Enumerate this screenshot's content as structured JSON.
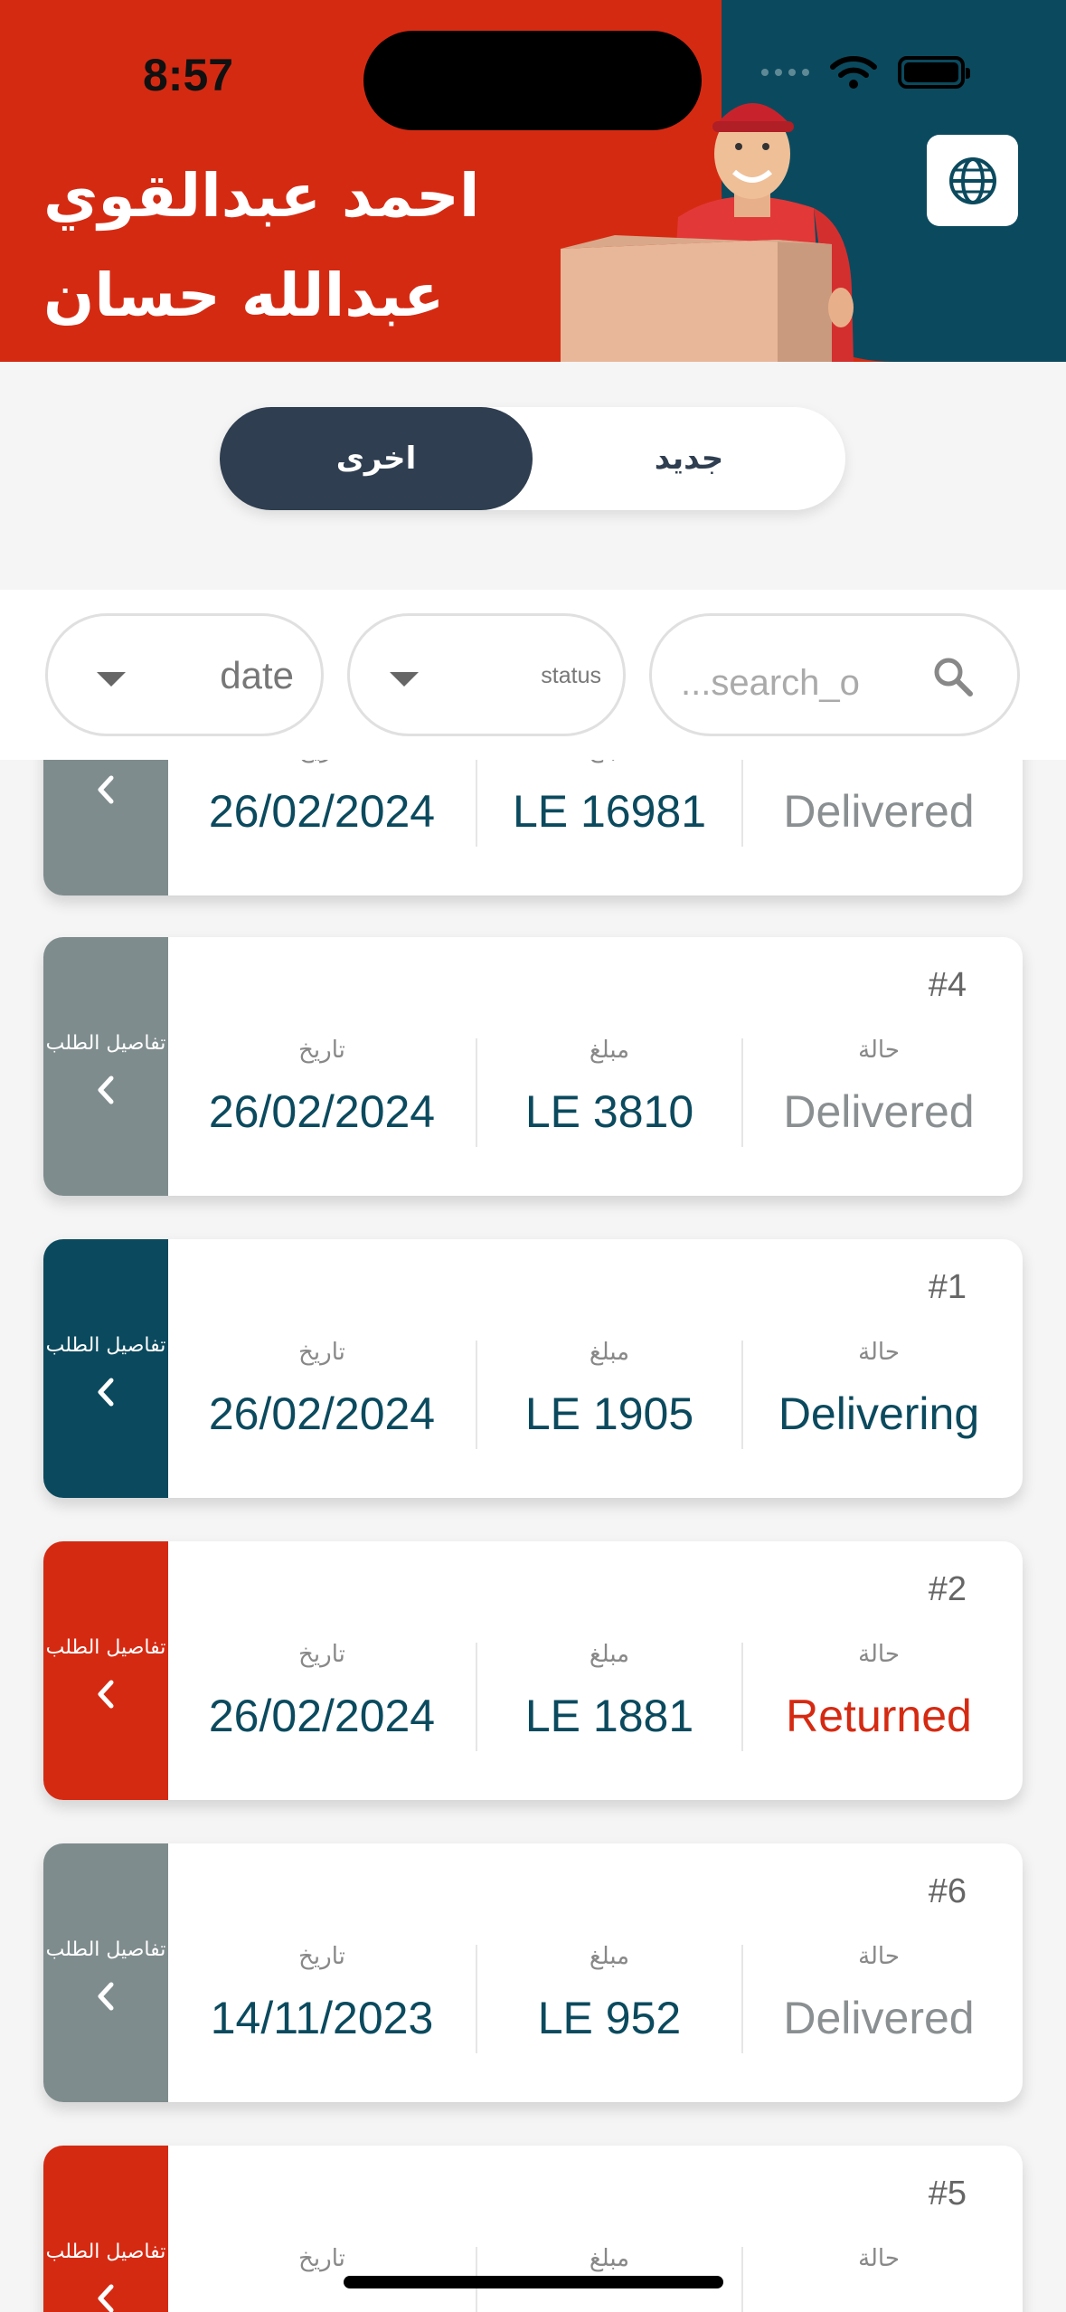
{
  "status_bar": {
    "time": "8:57"
  },
  "header": {
    "user_name": "احمد عبدالقوي عبدالله حسان"
  },
  "toggle": {
    "active_label": "اخرى",
    "inactive_label": "جديد"
  },
  "filters": {
    "date_label": "date",
    "status_label": "status",
    "search_placeholder": "...search_o"
  },
  "labels": {
    "details": "تفاصيل الطلب",
    "date": "تاريخ",
    "amount": "مبلغ",
    "status": "حالة"
  },
  "colors": {
    "red": "#d52a12",
    "teal": "#0b4a5e",
    "gray": "#7f8c8d",
    "navy": "#2f3e50"
  },
  "orders": [
    {
      "number": "",
      "date": "26/02/2024",
      "amount": "LE 16981",
      "status": "Delivered",
      "status_color": "#8a8f91",
      "side_color": "#7f8c8d"
    },
    {
      "number": "#4",
      "date": "26/02/2024",
      "amount": "LE 3810",
      "status": "Delivered",
      "status_color": "#8a8f91",
      "side_color": "#7f8c8d"
    },
    {
      "number": "#1",
      "date": "26/02/2024",
      "amount": "LE 1905",
      "status": "Delivering",
      "status_color": "#0b4a5e",
      "side_color": "#0b4a5e"
    },
    {
      "number": "#2",
      "date": "26/02/2024",
      "amount": "LE 1881",
      "status": "Returned",
      "status_color": "#d52a12",
      "side_color": "#d52a12"
    },
    {
      "number": "#6",
      "date": "14/11/2023",
      "amount": "LE 952",
      "status": "Delivered",
      "status_color": "#8a8f91",
      "side_color": "#7f8c8d"
    },
    {
      "number": "#5",
      "date": "",
      "amount": "",
      "status": "",
      "status_color": "#d52a12",
      "side_color": "#d52a12"
    }
  ]
}
